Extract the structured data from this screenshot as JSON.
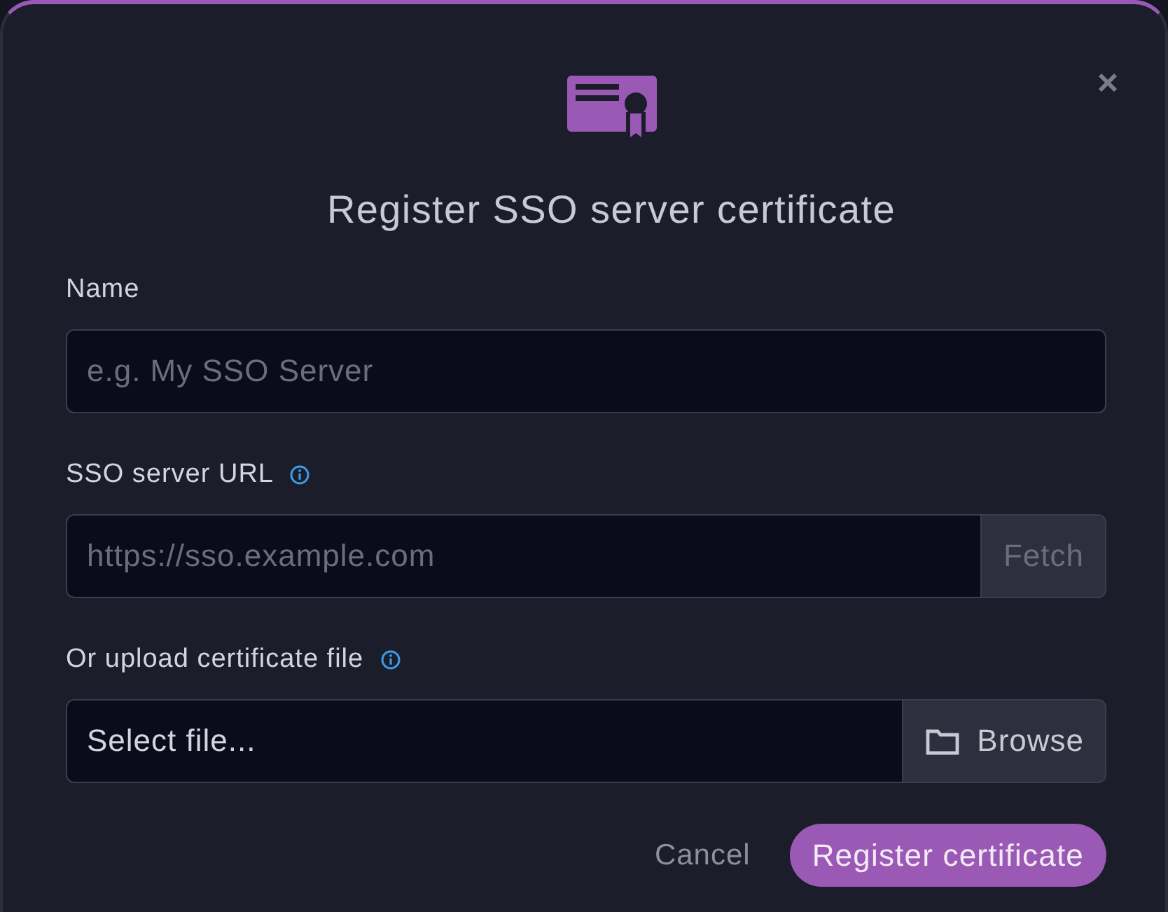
{
  "dialog": {
    "title": "Register SSO server certificate"
  },
  "fields": [
    {
      "kind": "text",
      "label": "Name",
      "placeholder": "e.g. My SSO Server"
    },
    {
      "kind": "text_with_button",
      "label": "SSO server URL",
      "info": true,
      "placeholder": "https://sso.example.com",
      "button": {
        "label": "Fetch",
        "disabled": true
      }
    },
    {
      "kind": "file",
      "label": "Or upload certificate file",
      "info": true,
      "value": "Select file...",
      "button": {
        "label": "Browse",
        "disabled": false
      }
    }
  ],
  "actions": [
    {
      "kind": "text",
      "label": "Cancel"
    },
    {
      "kind": "primary",
      "label": "Register certificate"
    }
  ]
}
